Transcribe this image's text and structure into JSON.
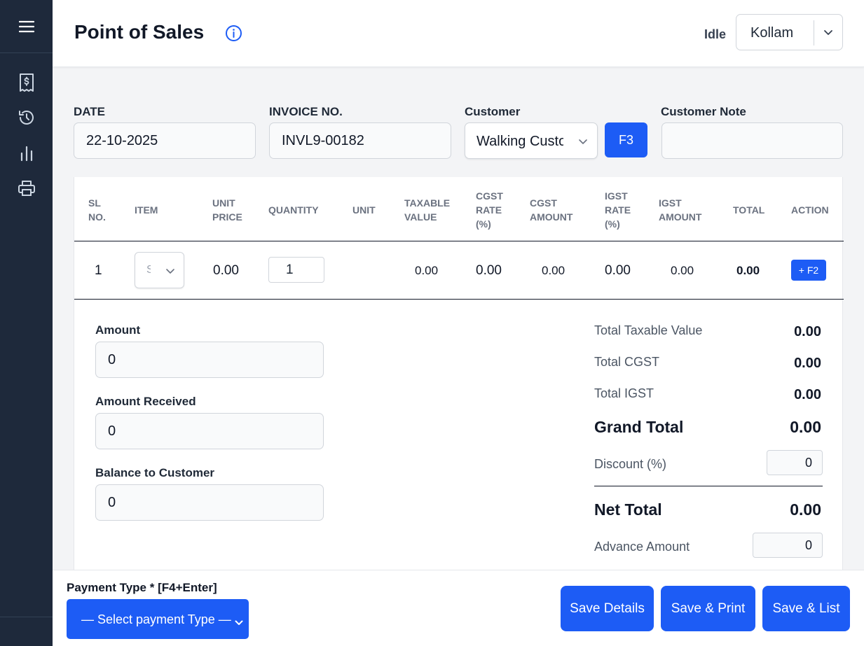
{
  "header": {
    "title": "Point of Sales",
    "status": "Idle",
    "branch": "Kollam"
  },
  "sidebar": {
    "icons": [
      "menu-icon",
      "receipt-icon",
      "history-icon",
      "chart-icon",
      "printer-icon"
    ]
  },
  "form": {
    "date_label": "DATE",
    "date_value": "22-10-2025",
    "invoice_label": "INVOICE NO.",
    "invoice_value": "INVL9-00182",
    "customer_label": "Customer",
    "customer_value": "Walking Customer",
    "customer_button": "F3",
    "note_label": "Customer Note",
    "note_value": ""
  },
  "table": {
    "headers": {
      "sl": [
        "SL",
        "NO."
      ],
      "item": [
        "ITEM"
      ],
      "unit_price": [
        "UNIT",
        "PRICE"
      ],
      "quantity": [
        "QUANTITY"
      ],
      "unit": [
        "UNIT"
      ],
      "taxable": [
        "TAXABLE",
        "VALUE"
      ],
      "cgst_rate": [
        "CGST",
        "RATE",
        "(%)"
      ],
      "cgst_amount": [
        "CGST",
        "AMOUNT"
      ],
      "igst_rate": [
        "IGST",
        "RATE",
        "(%)"
      ],
      "igst_amount": [
        "IGST",
        "AMOUNT"
      ],
      "total": [
        "TOTAL"
      ],
      "action": [
        "ACTION"
      ]
    },
    "rows": [
      {
        "sl": "1",
        "item": "S",
        "unit_price": "0.00",
        "quantity": "1",
        "unit": "",
        "taxable": "0.00",
        "cgst_rate": "0.00",
        "cgst_amount": "0.00",
        "igst_rate": "0.00",
        "igst_amount": "0.00",
        "total": "0.00",
        "action": "+ F2"
      }
    ]
  },
  "amounts": {
    "amount_label": "Amount",
    "amount_value": "0",
    "received_label": "Amount Received",
    "received_value": "0",
    "balance_label": "Balance to Customer",
    "balance_value": "0"
  },
  "totals": {
    "taxable_label": "Total Taxable Value",
    "taxable_value": "0.00",
    "cgst_label": "Total CGST",
    "cgst_value": "0.00",
    "igst_label": "Total IGST",
    "igst_value": "0.00",
    "grand_label": "Grand Total",
    "grand_value": "0.00",
    "discount_label": "Discount (%)",
    "discount_value": "0",
    "net_label": "Net Total",
    "net_value": "0.00",
    "advance_label": "Advance Amount",
    "advance_value": "0"
  },
  "footer": {
    "payment_label": "Payment Type * [F4+Enter]",
    "payment_value": "— Select payment Type —",
    "save_details": "Save Details",
    "save_print": "Save & Print",
    "save_list": "Save & List"
  },
  "colors": {
    "sidebar": "#1e293b",
    "primary": "#1d5cf5"
  }
}
